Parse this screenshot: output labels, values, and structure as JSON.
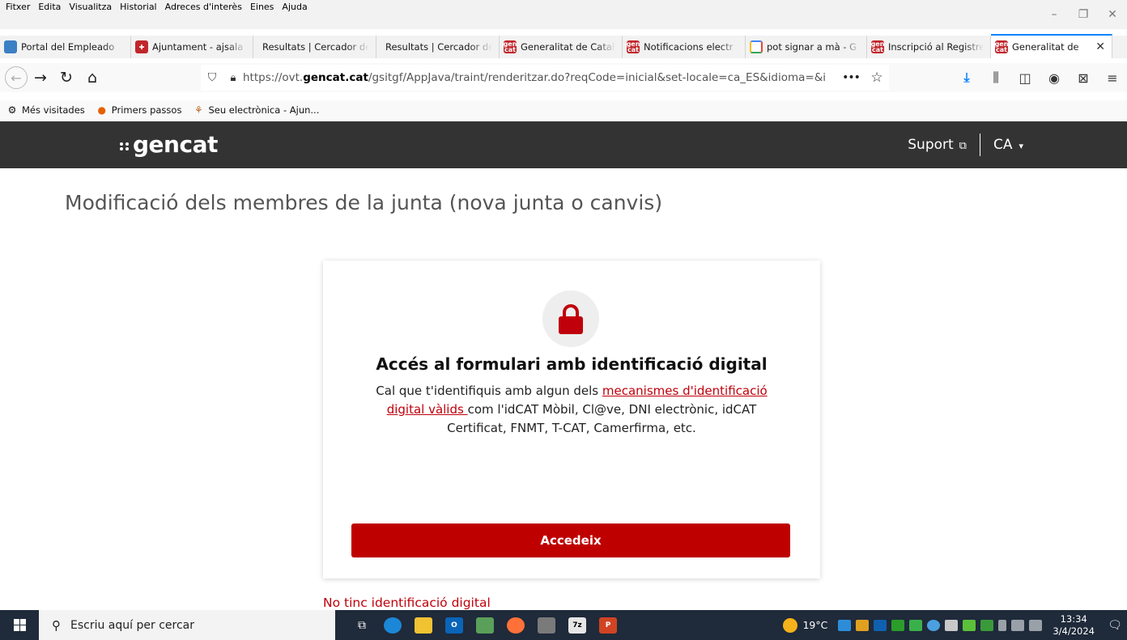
{
  "browser": {
    "menu": [
      "Fitxer",
      "Edita",
      "Visualitza",
      "Historial",
      "Adreces d'interès",
      "Eines",
      "Ajuda"
    ],
    "tabs": [
      {
        "label": "Portal del Empleado",
        "icon": "globe-icon"
      },
      {
        "label": "Ajuntament - ajsala",
        "icon": "ajuntament-icon"
      },
      {
        "label": "Resultats | Cercador de",
        "icon": ""
      },
      {
        "label": "Resultats | Cercador de",
        "icon": ""
      },
      {
        "label": "Generalitat de Catalu",
        "icon": "gencat-icon"
      },
      {
        "label": "Notificacions electr",
        "icon": "gencat-icon"
      },
      {
        "label": "pot signar a mà - G",
        "icon": "google-icon"
      },
      {
        "label": "Inscripció al Registre",
        "icon": "gencat-icon"
      },
      {
        "label": "Generalitat de",
        "icon": "gencat-icon",
        "active": true
      }
    ],
    "url_prefix": "https://ovt.",
    "url_domain": "gencat.cat",
    "url_path": "/gsitgf/AppJava/traint/renderitzar.do?reqCode=inicial&set-locale=ca_ES&idioma=&i",
    "bookmarks": [
      "Més visitades",
      "Primers passos",
      "Seu electrònica - Ajun..."
    ]
  },
  "site": {
    "logo": "gencat",
    "support": "Suport",
    "language": "CA"
  },
  "page": {
    "title": "Modificació dels membres de la junta (nova junta o canvis)",
    "card_title": "Accés al formulari amb identificació digital",
    "desc_before": "Cal que t'identifiquis amb algun dels ",
    "desc_link": "mecanismes d'identificació digital vàlids ",
    "desc_after": "com l'idCAT Mòbil, Cl@ve, DNI electrònic, idCAT Certificat, FNMT, T-CAT, Camerfirma, etc.",
    "access_button": "Accedeix",
    "no_digital": "No tinc identificació digital"
  },
  "taskbar": {
    "search_placeholder": "Escriu aquí per cercar",
    "temperature": "19°C",
    "time": "13:34",
    "date": "3/4/2024"
  },
  "colors": {
    "gencat_red": "#bf0000",
    "header_bg": "#333333"
  }
}
